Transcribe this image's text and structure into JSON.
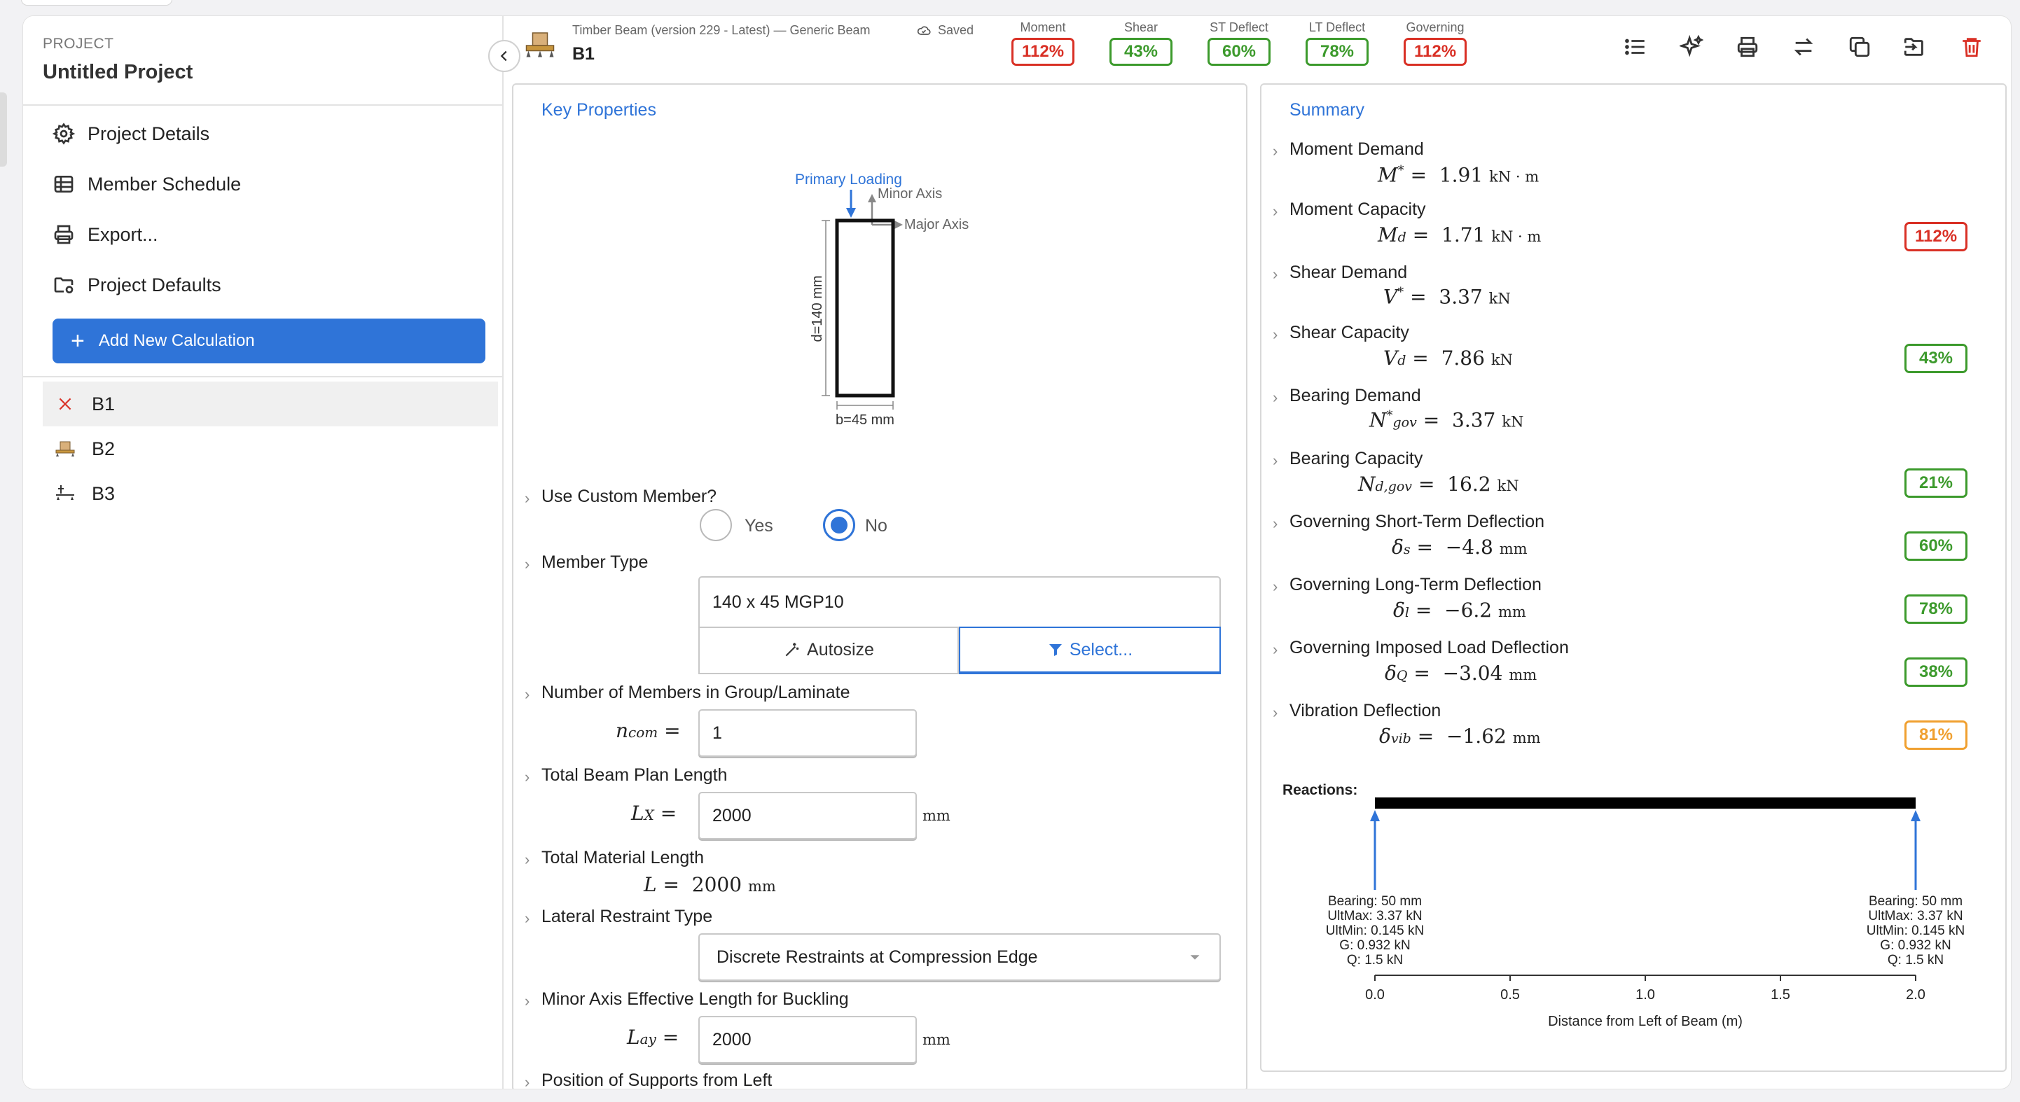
{
  "sidebar": {
    "project_label": "PROJECT",
    "project_title": "Untitled Project",
    "nav": [
      {
        "label": "Project Details",
        "icon": "gear-icon"
      },
      {
        "label": "Member Schedule",
        "icon": "table-icon"
      },
      {
        "label": "Export...",
        "icon": "printer-icon"
      },
      {
        "label": "Project Defaults",
        "icon": "folder-settings-icon"
      }
    ],
    "add_button": "Add New Calculation",
    "calcs": [
      {
        "label": "B1",
        "icon": "error-x-icon"
      },
      {
        "label": "B2",
        "icon": "beam-icon"
      },
      {
        "label": "B3",
        "icon": "beam-icon"
      }
    ]
  },
  "header": {
    "subtitle": "Timber Beam (version 229 - Latest) — Generic Beam",
    "saved": "Saved",
    "title": "B1",
    "metrics": [
      {
        "label": "Moment",
        "value": "112%",
        "status": "red"
      },
      {
        "label": "Shear",
        "value": "43%",
        "status": "green"
      },
      {
        "label": "ST Deflect",
        "value": "60%",
        "status": "green"
      },
      {
        "label": "LT Deflect",
        "value": "78%",
        "status": "green"
      },
      {
        "label": "Governing",
        "value": "112%",
        "status": "red"
      }
    ],
    "tools": [
      "list-icon",
      "sparkles-icon",
      "printer-icon",
      "swap-icon",
      "copy-icon",
      "move-icon",
      "trash-icon"
    ]
  },
  "key_properties": {
    "title": "Key Properties",
    "diagram": {
      "primary_loading": "Primary Loading",
      "minor_axis": "Minor Axis",
      "major_axis": "Major Axis",
      "depth": "d=140 mm",
      "breadth": "b=45 mm"
    },
    "custom_member": {
      "label": "Use Custom Member?",
      "yes": "Yes",
      "no": "No",
      "selected": "No"
    },
    "member_type": {
      "label": "Member Type",
      "value": "140 x 45 MGP10",
      "autosize": "Autosize",
      "select": "Select..."
    },
    "n_members": {
      "label": "Number of Members in Group/Laminate",
      "value": "1"
    },
    "plan_length": {
      "label": "Total Beam Plan Length",
      "value": "2000",
      "unit": "mm"
    },
    "material_length": {
      "label": "Total Material Length",
      "value": "2000",
      "unit": "mm"
    },
    "lateral_restraint": {
      "label": "Lateral Restraint Type",
      "value": "Discrete Restraints at Compression Edge"
    },
    "minor_buckling": {
      "label": "Minor Axis Effective Length for Buckling",
      "value": "2000",
      "unit": "mm"
    },
    "supports": {
      "label": "Position of Supports from Left"
    }
  },
  "summary": {
    "title": "Summary",
    "items": [
      {
        "label": "Moment Demand",
        "value": "1.91",
        "unit": "kN · m",
        "badge": "",
        "status": ""
      },
      {
        "label": "Moment Capacity",
        "value": "1.71",
        "unit": "kN · m",
        "badge": "112%",
        "status": "red"
      },
      {
        "label": "Shear Demand",
        "value": "3.37",
        "unit": "kN",
        "badge": "",
        "status": ""
      },
      {
        "label": "Shear Capacity",
        "value": "7.86",
        "unit": "kN",
        "badge": "43%",
        "status": "green"
      },
      {
        "label": "Bearing Demand",
        "value": "3.37",
        "unit": "kN",
        "badge": "",
        "status": ""
      },
      {
        "label": "Bearing Capacity",
        "value": "16.2",
        "unit": "kN",
        "badge": "21%",
        "status": "green"
      },
      {
        "label": "Governing Short-Term Deflection",
        "value": "−4.8",
        "unit": "mm",
        "badge": "60%",
        "status": "green"
      },
      {
        "label": "Governing Long-Term Deflection",
        "value": "−6.2",
        "unit": "mm",
        "badge": "78%",
        "status": "green"
      },
      {
        "label": "Governing Imposed Load Deflection",
        "value": "−3.04",
        "unit": "mm",
        "badge": "38%",
        "status": "green"
      },
      {
        "label": "Vibration Deflection",
        "value": "−1.62",
        "unit": "mm",
        "badge": "81%",
        "status": "orange"
      }
    ],
    "reactions": {
      "title": "Reactions:",
      "xlabel": "Distance from Left of Beam (m)",
      "ticks": [
        "0.0",
        "0.5",
        "1.0",
        "1.5",
        "2.0"
      ],
      "left": [
        "Bearing: 50 mm",
        "UltMax: 3.37 kN",
        "UltMin: 0.145 kN",
        "G: 0.932 kN",
        "Q: 1.5 kN"
      ],
      "right": [
        "Bearing: 50 mm",
        "UltMax: 3.37 kN",
        "UltMin: 0.145 kN",
        "G: 0.932 kN",
        "Q: 1.5 kN"
      ]
    }
  },
  "colors": {
    "accent": "#2f74d8",
    "red": "#d93025",
    "green": "#4caf34",
    "orange": "#f0a030"
  }
}
